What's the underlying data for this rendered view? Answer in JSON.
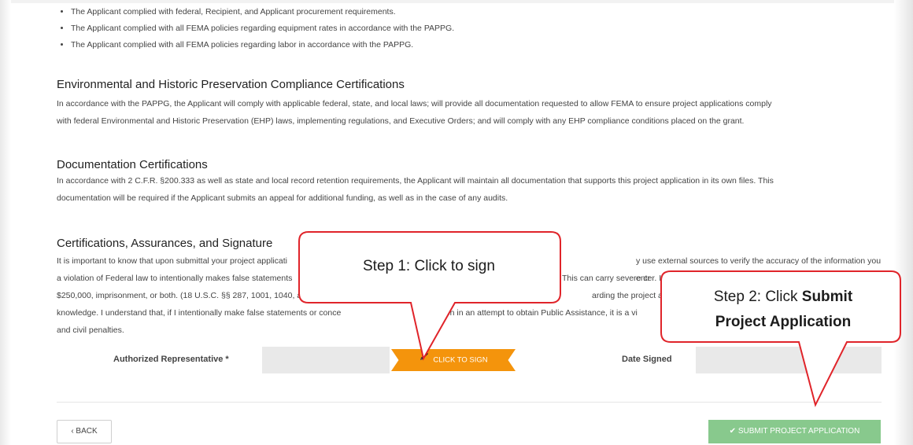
{
  "compliance_bullets": [
    "The Applicant complied with federal, Recipient, and Applicant procurement requirements.",
    "The Applicant complied with all FEMA policies regarding equipment rates in accordance with the PAPPG.",
    "The Applicant complied with all FEMA policies regarding labor in accordance with the PAPPG."
  ],
  "sections": {
    "ehp": {
      "title": "Environmental and Historic Preservation Compliance Certifications",
      "line1": "In accordance with the PAPPG, the Applicant will comply with applicable federal, state, and local laws; will provide all documentation requested to allow FEMA to ensure project applications comply",
      "line2": "with federal Environmental and Historic Preservation (EHP) laws, implementing regulations, and Executive Orders; and will comply with any EHP compliance conditions placed on the grant."
    },
    "documentation": {
      "title": "Documentation Certifications",
      "line1": "In accordance with 2 C.F.R. §200.333 as well as state and local record retention requirements, the Applicant will maintain all documentation that supports this project application in its own files. This",
      "line2": "documentation will be required if the Applicant submits an appeal for additional funding, as well as in the case of any audits."
    },
    "signature": {
      "title": "Certifications, Assurances, and Signature",
      "line1": "It is important to know that upon submittal your project applicati",
      "line1b": "y use external sources to verify the accuracy of the information you enter. It is",
      "line2": "a violation of Federal law to intentionally makes false statements",
      "line2b": "This can carry severe cr",
      "line3": "$250,000, imprisonment, or both. (18 U.S.C. §§ 287, 1001, 1040, a",
      "line3b": "arding the project applic",
      "line4": "knowledge. I understand that, if I intentionally make false statements or conce",
      "line4b": "mation in an attempt to obtain Public Assistance, it is a vi",
      "line5": "and civil penalties."
    }
  },
  "form": {
    "authorized_rep_label": "Authorized Representative *",
    "sign_button": "CLICK TO SIGN",
    "date_signed_label": "Date Signed"
  },
  "footer": {
    "back_label": "‹ BACK",
    "submit_label": "✔ SUBMIT PROJECT APPLICATION"
  },
  "callouts": {
    "step1": "Step 1: Click to sign",
    "step2_plain": "Step 2: Click ",
    "step2_bold1": "Submit",
    "step2_bold2": "Project Application"
  },
  "colors": {
    "sign_button": "#f4940c",
    "submit_button": "#88c98d",
    "callout_border": "#e0242a"
  }
}
